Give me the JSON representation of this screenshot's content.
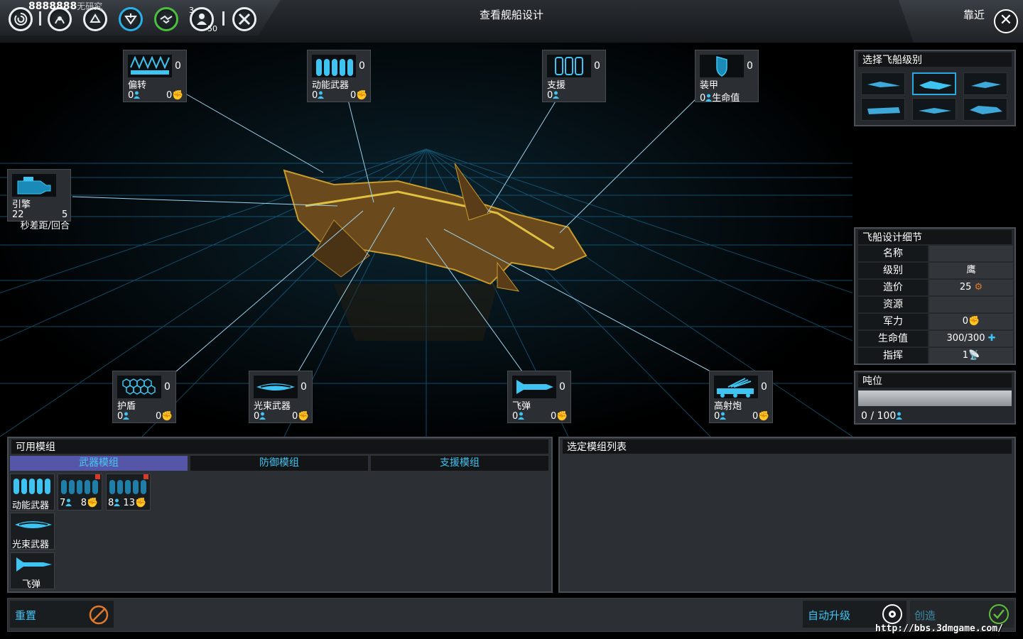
{
  "topbar": {
    "research_value": "8888888",
    "research_label": "无研究",
    "badge_top": "3",
    "badge_bottom": "50",
    "title": "查看舰船设计",
    "zoom_label": "靠近",
    "icons": [
      "galaxy-icon",
      "empire-icon",
      "tech-icon",
      "military-icon",
      "diplomacy-icon",
      "population-icon",
      "tools-icon"
    ]
  },
  "modules": {
    "deflector": {
      "label": "偏转",
      "count": "0",
      "crew": "0",
      "power": "0"
    },
    "kinetic": {
      "label": "动能武器",
      "count": "0",
      "crew": "0",
      "power": "0"
    },
    "support": {
      "label": "支援",
      "count": "0",
      "crew": "0"
    },
    "armor": {
      "label": "装甲",
      "count": "0",
      "crew": "0",
      "stat": "生命值"
    },
    "engine": {
      "label": "引擎",
      "v1": "22",
      "v2": "5",
      "stat": "秒差距/回合"
    },
    "shield": {
      "label": "护盾",
      "count": "0",
      "crew": "0",
      "power": "0"
    },
    "beam": {
      "label": "光束武器",
      "count": "0",
      "crew": "0",
      "power": "0"
    },
    "missile": {
      "label": "飞弹",
      "count": "0",
      "crew": "0",
      "power": "0"
    },
    "flak": {
      "label": "高射炮",
      "count": "0",
      "crew": "0",
      "power": "0"
    }
  },
  "class_panel": {
    "title": "选择飞船级别",
    "selected_index": 1,
    "thumb_count": 6
  },
  "details": {
    "title": "飞船设计细节",
    "rows": [
      {
        "key": "名称",
        "value": ""
      },
      {
        "key": "级别",
        "value": "鹰"
      },
      {
        "key": "造价",
        "value": "25"
      },
      {
        "key": "资源",
        "value": ""
      },
      {
        "key": "军力",
        "value": "0"
      },
      {
        "key": "生命值",
        "value": "300/300"
      },
      {
        "key": "指挥",
        "value": "1"
      }
    ]
  },
  "tonnage": {
    "title": "吨位",
    "value": "0 / 100",
    "fill_fraction": 0.0
  },
  "available": {
    "title": "可用模组",
    "tabs": [
      "武器模组",
      "防御模组",
      "支援模组"
    ],
    "active_tab": 0,
    "items": [
      {
        "label": "动能武器"
      },
      {
        "crew": "7",
        "power": "8"
      },
      {
        "crew": "8",
        "power": "13"
      },
      {
        "label": "光束武器"
      },
      {
        "label": "飞弹"
      }
    ]
  },
  "selected_list": {
    "title": "选定模组列表"
  },
  "actions": {
    "reset": "重置",
    "auto_upgrade": "自动升级",
    "create": "创造"
  },
  "watermark": "http://bbs.3dmgame.com/",
  "colors": {
    "accent": "#3ec4f2",
    "tab_active": "#5556a8",
    "reset_icon": "#e07a2a",
    "create_icon": "#5fbf3a"
  }
}
